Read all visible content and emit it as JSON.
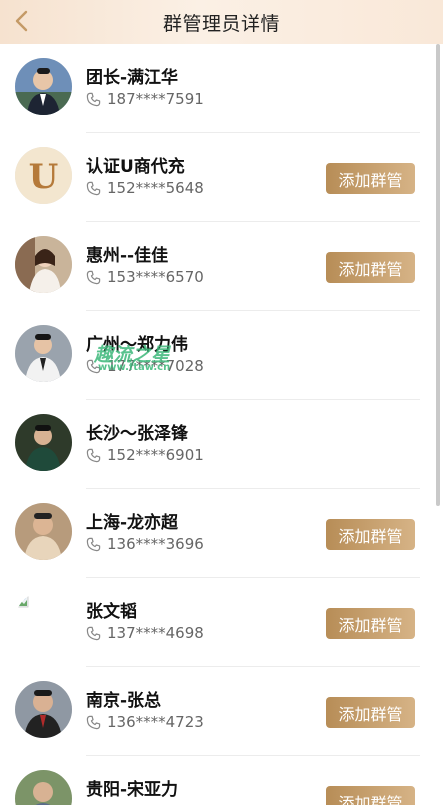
{
  "header": {
    "title": "群管理员详情",
    "back_icon": "chevron-left-icon",
    "back_color": "#c49a66"
  },
  "accent": {
    "button_gradient_start": "#b78d57",
    "button_gradient_end": "#d6b386"
  },
  "members": [
    {
      "name": "团长-满江华",
      "phone": "187****7591",
      "action": ""
    },
    {
      "name": "认证U商代充",
      "phone": "152****5648",
      "action": "添加群管"
    },
    {
      "name": "惠州--佳佳",
      "phone": "153****6570",
      "action": "添加群管"
    },
    {
      "name": "广州～郑力伟",
      "phone": "177****7028",
      "action": ""
    },
    {
      "name": "长沙～张泽锋",
      "phone": "152****6901",
      "action": ""
    },
    {
      "name": "上海-龙亦超",
      "phone": "136****3696",
      "action": "添加群管"
    },
    {
      "name": "张文韬",
      "phone": "137****4698",
      "action": "添加群管"
    },
    {
      "name": "南京-张总",
      "phone": "136****4723",
      "action": "添加群管"
    },
    {
      "name": "贵阳-宋亚力",
      "phone": "",
      "action": "添加群管"
    }
  ],
  "watermark": {
    "line1": "趣流之星",
    "line2": "www.ftaw.cn"
  }
}
